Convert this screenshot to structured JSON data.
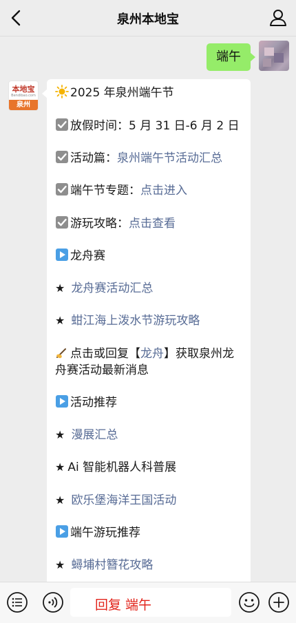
{
  "header": {
    "title": "泉州本地宝"
  },
  "user_message": {
    "text": "端午"
  },
  "bot": {
    "logo_text": "本地宝",
    "logo_sub": "Bendibao.com",
    "logo_city": "泉州",
    "lines": [
      {
        "prefix": "",
        "text": "2025 年泉州端午节",
        "link": ""
      },
      {
        "prefix": "放假时间：",
        "text": "5 月 31 日-6 月 2 日",
        "link": ""
      },
      {
        "prefix": "活动篇：",
        "text": "",
        "link": "泉州端午节活动汇总"
      },
      {
        "prefix": "端午节专题：",
        "text": "",
        "link": "点击进入"
      },
      {
        "prefix": "游玩攻略：",
        "text": "",
        "link": "点击查看"
      },
      {
        "prefix": "",
        "text": "龙舟赛",
        "link": ""
      },
      {
        "prefix": "★ ",
        "text": "",
        "link": "龙舟赛活动汇总"
      },
      {
        "prefix": "★ ",
        "text": "",
        "link": "蚶江海上泼水节游玩攻略"
      },
      {
        "prefix": "点击或回复【",
        "link": "龙舟",
        "suffix": "】获取泉州龙舟赛活动最新消息"
      },
      {
        "prefix": "",
        "text": "活动推荐",
        "link": ""
      },
      {
        "prefix": "★ ",
        "text": "",
        "link": "漫展汇总"
      },
      {
        "prefix": "★",
        "text": "Ai 智能机器人科普展",
        "link": ""
      },
      {
        "prefix": "★ ",
        "text": "",
        "link": "欧乐堡海洋王国活动"
      },
      {
        "prefix": "",
        "text": "端午游玩推荐",
        "link": ""
      },
      {
        "prefix": "★ ",
        "text": "",
        "link": "蟳埔村簪花攻略"
      }
    ]
  },
  "input": {
    "text": "回复 端午"
  },
  "icons": {
    "back": "chevron-left-icon",
    "user": "user-icon",
    "menu": "list-icon",
    "voice": "voice-icon",
    "emoji": "emoji-icon",
    "plus": "plus-icon",
    "sun": "sun-icon",
    "check": "checkbox-icon",
    "play": "play-icon",
    "hand": "writing-hand-icon"
  },
  "colors": {
    "link": "#576b95",
    "bubble_green": "#95ec69",
    "input_red": "#e2231a"
  }
}
